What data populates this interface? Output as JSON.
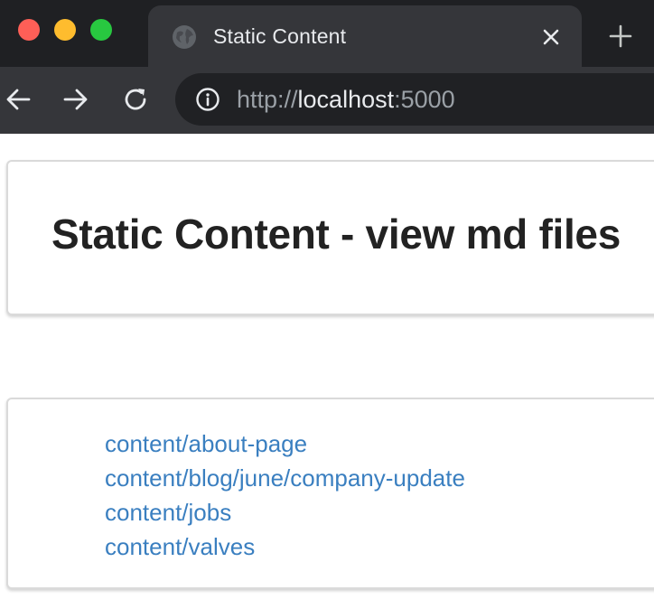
{
  "browser": {
    "tab_title": "Static Content",
    "url_scheme": "http://",
    "url_host": "localhost",
    "url_port": ":5000"
  },
  "page": {
    "title": "Static Content - view md files",
    "links": [
      {
        "label": "content/about-page"
      },
      {
        "label": "content/blog/june/company-update"
      },
      {
        "label": "content/jobs"
      },
      {
        "label": "content/valves"
      }
    ]
  },
  "colors": {
    "tabbar_bg": "#1f2023",
    "toolbar_bg": "#35363a",
    "link": "#3a7fc0",
    "title_text": "#222222"
  },
  "icons": [
    "globe-icon",
    "close-icon",
    "plus-icon",
    "back-arrow-icon",
    "forward-arrow-icon",
    "reload-icon",
    "info-icon"
  ]
}
